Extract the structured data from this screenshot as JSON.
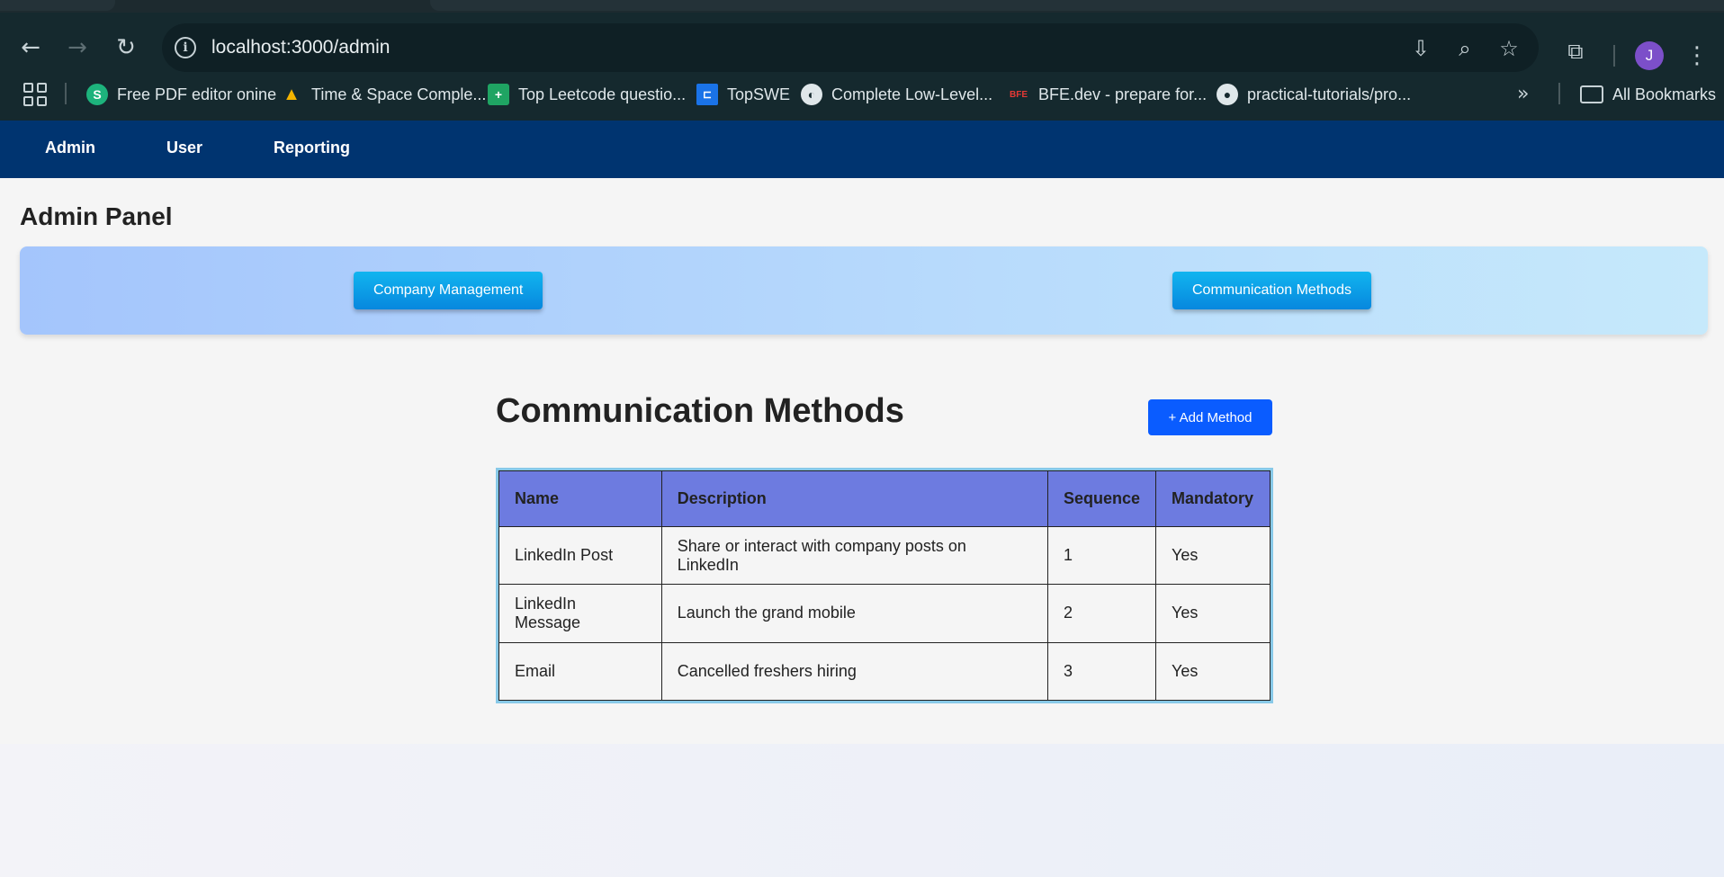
{
  "browser": {
    "url": "localhost:3000/admin",
    "avatar_letter": "J",
    "bookmarks": [
      {
        "label": "Free PDF editor onine",
        "icon": "sejda-icon",
        "color": "#1db37c",
        "glyph": "S"
      },
      {
        "label": "Time & Space Comple...",
        "icon": "google-drive-icon",
        "color": "#f4b400",
        "glyph": "▲"
      },
      {
        "label": "Top Leetcode questio...",
        "icon": "google-sheets-icon",
        "color": "#1fa463",
        "glyph": "+"
      },
      {
        "label": "TopSWE",
        "icon": "topswe-icon",
        "color": "#1a73e8",
        "glyph": "⊏"
      },
      {
        "label": "Complete Low-Level...",
        "icon": "globe-icon",
        "color": "#5f6b6e",
        "glyph": "●"
      },
      {
        "label": "BFE.dev - prepare for...",
        "icon": "bfe-icon",
        "color": "#e53935",
        "glyph": "BFE"
      },
      {
        "label": "practical-tutorials/pro...",
        "icon": "github-icon",
        "color": "#3a3f42",
        "glyph": "●"
      }
    ],
    "all_bookmarks_label": "All Bookmarks"
  },
  "nav": {
    "items": [
      "Admin",
      "User",
      "Reporting"
    ]
  },
  "page": {
    "title": "Admin Panel",
    "banner_buttons": [
      "Company Management",
      "Communication Methods"
    ]
  },
  "section": {
    "title": "Communication Methods",
    "add_button": "+ Add Method"
  },
  "table": {
    "headers": [
      "Name",
      "Description",
      "Sequence",
      "Mandatory"
    ],
    "rows": [
      [
        "LinkedIn Post",
        "Share or interact with company posts on LinkedIn",
        "1",
        "Yes"
      ],
      [
        "LinkedIn Message",
        "Launch the grand mobile",
        "2",
        "Yes"
      ],
      [
        "Email",
        "Cancelled freshers hiring",
        "3",
        "Yes"
      ]
    ]
  }
}
